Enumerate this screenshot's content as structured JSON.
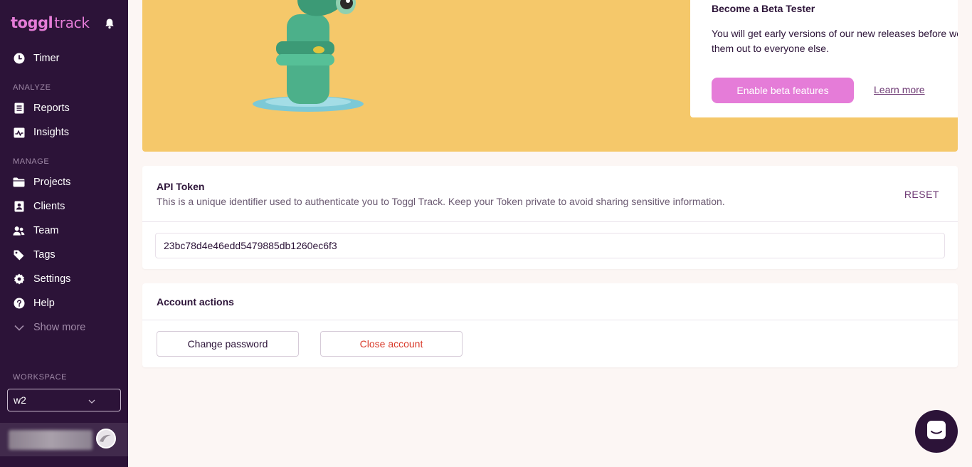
{
  "brand": {
    "name_bold": "toggl",
    "name_light": "track"
  },
  "sidebar": {
    "timer": "Timer",
    "analyze_label": "ANALYZE",
    "analyze": [
      "Reports",
      "Insights"
    ],
    "manage_label": "MANAGE",
    "manage": [
      "Projects",
      "Clients",
      "Team",
      "Tags",
      "Settings",
      "Help"
    ],
    "show_more": "Show more",
    "workspace_label": "WORKSPACE",
    "workspace_value": "w2"
  },
  "beta": {
    "title": "Become a Beta Tester",
    "description": "You will get early versions of our new releases before we roll them out to everyone else.",
    "button": "Enable beta features",
    "link": "Learn more"
  },
  "api": {
    "title": "API Token",
    "description": "This is a unique identifier used to authenticate you to Toggl Track. Keep your Token private to avoid sharing sensitive information.",
    "reset": "RESET",
    "token": "23bc78d4e46edd5479885db1260ec6f3"
  },
  "account": {
    "title": "Account actions",
    "change_password": "Change password",
    "close_account": "Close account"
  },
  "colors": {
    "sidebar_bg": "#2c1338",
    "accent_pink": "#e57cd8",
    "banner_yellow": "#f5c86a",
    "danger": "#d93b2b"
  }
}
